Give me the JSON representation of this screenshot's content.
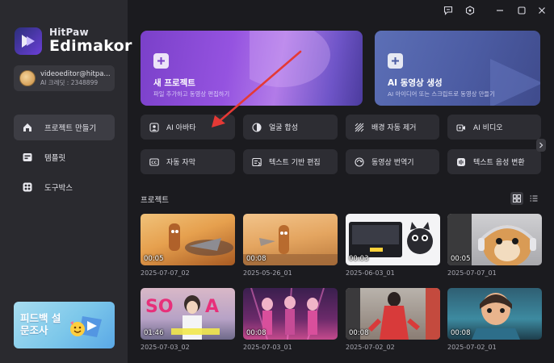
{
  "app": {
    "brand_line1": "HitPaw",
    "brand_line2": "Edimakor"
  },
  "account": {
    "email": "videoeditor@hitpa...",
    "credits": "AI 크레딧 : 2348899"
  },
  "sidebar": {
    "items": [
      {
        "label": "프로젝트 만들기",
        "icon": "home-icon",
        "active": true
      },
      {
        "label": "템플릿",
        "icon": "template-icon",
        "active": false
      },
      {
        "label": "도구박스",
        "icon": "toolbox-icon",
        "active": false
      }
    ],
    "survey_label": "피드백 설문조사"
  },
  "hero": {
    "new_project": {
      "title": "새 프로젝트",
      "subtitle": "파일 추가하고 동영상 편집하기"
    },
    "ai_video": {
      "title": "AI 동영상 생성",
      "subtitle": "AI 아이디어 또는 스크립트로 동영상 만들기"
    }
  },
  "tools": [
    {
      "label": "AI 아바타",
      "icon": "avatar-icon"
    },
    {
      "label": "얼굴 합성",
      "icon": "face-swap-icon"
    },
    {
      "label": "배경 자동 제거",
      "icon": "background-remove-icon"
    },
    {
      "label": "AI 비디오",
      "icon": "ai-video-icon"
    },
    {
      "label": "자동 자막",
      "icon": "caption-icon"
    },
    {
      "label": "텍스트 기반 편집",
      "icon": "text-edit-icon"
    },
    {
      "label": "동영상 번역기",
      "icon": "translate-icon"
    },
    {
      "label": "텍스트 음성 변환",
      "icon": "text-to-speech-icon"
    }
  ],
  "projects_section": {
    "title": "프로젝트",
    "items": [
      {
        "name": "2025-07-07_02",
        "duration": "00:05"
      },
      {
        "name": "2025-05-26_01",
        "duration": "00:08"
      },
      {
        "name": "2025-06-03_01",
        "duration": "00:03"
      },
      {
        "name": "2025-07-07_01",
        "duration": "00:05"
      },
      {
        "name": "2025-07-03_02",
        "duration": "01:46"
      },
      {
        "name": "2025-07-03_01",
        "duration": "00:08"
      },
      {
        "name": "2025-07-02_02",
        "duration": "00:08"
      },
      {
        "name": "2025-07-02_01",
        "duration": "00:08"
      }
    ]
  },
  "colors": {
    "background": "#1b1b1f",
    "sidebar": "#2a2a2f",
    "tool_card": "#2d2d33",
    "annotation_arrow": "#e53935"
  }
}
